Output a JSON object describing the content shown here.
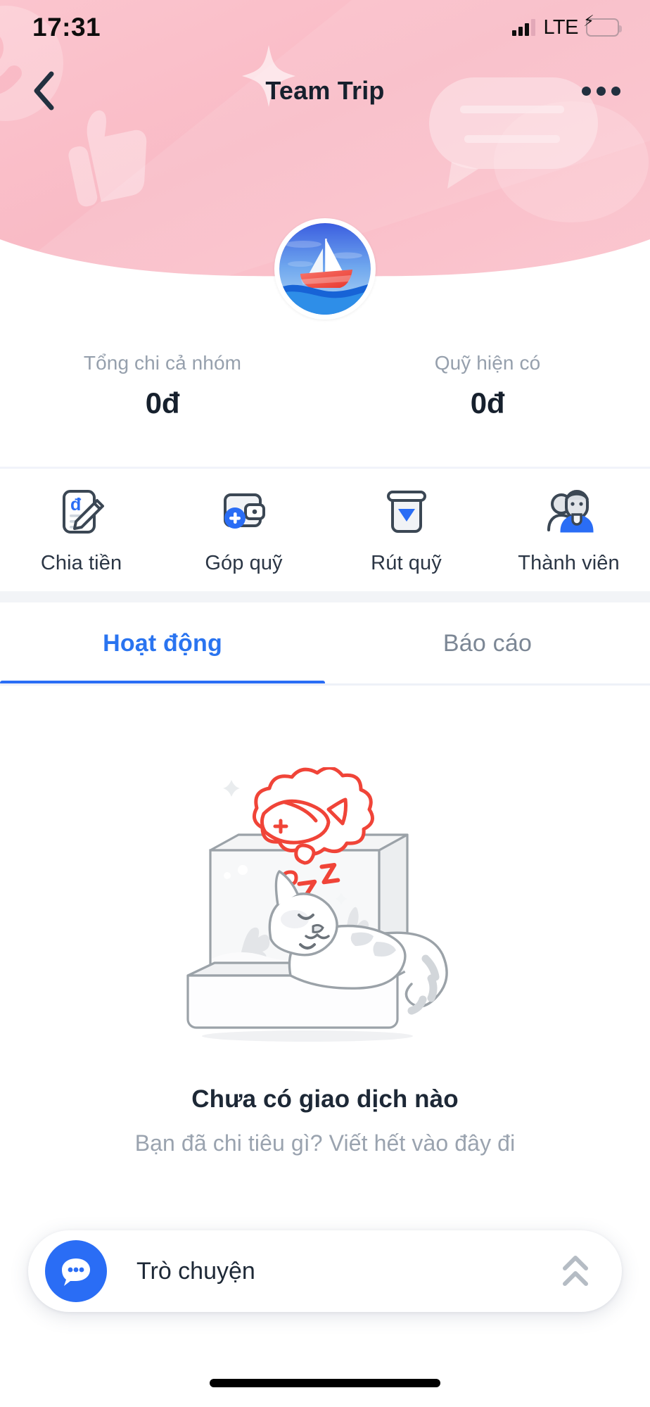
{
  "theme": {
    "header_pink": "#fac0ca",
    "header_pink_light": "#fbc9d2",
    "accent_blue": "#2a6df5",
    "text_dark": "#16202d",
    "text_muted": "#96a0ad",
    "battery_green": "#2ed156"
  },
  "status_bar": {
    "time": "17:31",
    "network_label": "LTE",
    "signal_icon": "signal-bars-icon",
    "battery_icon": "battery-charging-icon"
  },
  "nav": {
    "back_icon": "chevron-left-icon",
    "title": "Team Trip",
    "more_icon": "more-horizontal-icon"
  },
  "group": {
    "avatar_icon": "sailboat-avatar-icon"
  },
  "stats": [
    {
      "label": "Tổng chi cả nhóm",
      "value": "0đ"
    },
    {
      "label": "Quỹ hiện có",
      "value": "0đ"
    }
  ],
  "actions": [
    {
      "label": "Chia tiền",
      "icon": "split-bill-icon"
    },
    {
      "label": "Góp quỹ",
      "icon": "wallet-add-icon"
    },
    {
      "label": "Rút quỹ",
      "icon": "withdraw-icon"
    },
    {
      "label": "Thành viên",
      "icon": "members-icon"
    }
  ],
  "tabs": [
    {
      "label": "Hoạt động",
      "active": true
    },
    {
      "label": "Báo cáo",
      "active": false
    }
  ],
  "empty_state": {
    "illustration": "sleeping-cat-fishtank-illustration",
    "title": "Chưa có giao dịch nào",
    "subtitle": "Bạn đã chi tiêu gì? Viết hết vào đây đi"
  },
  "chat_bar": {
    "icon": "chat-bubble-icon",
    "label": "Trò chuyện",
    "expand_icon": "double-chevron-up-icon"
  }
}
